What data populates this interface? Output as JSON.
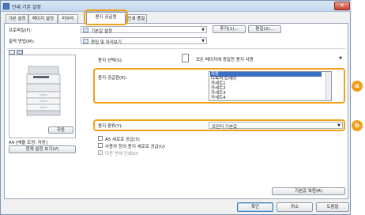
{
  "window": {
    "title": "인쇄 기본 설정",
    "close_glyph": "✕"
  },
  "tabs": [
    {
      "label": "기본 설정"
    },
    {
      "label": "페이지 설정"
    },
    {
      "label": "마무리"
    },
    {
      "label": "용지 공급원"
    },
    {
      "label": "인쇄 품질"
    }
  ],
  "top": {
    "profile_label": "프로파일(F):",
    "profile_value": "기본값 설정",
    "add_button": "추가(1)...",
    "edit_button": "편집(2)...",
    "output_label": "출력 방법(M):",
    "output_value": "편집 및 미리보기"
  },
  "paper": {
    "selection_label": "용지 선택(S):",
    "selection_value": "모든 페이지에 동일한 용지 사용",
    "source_label": "용지 공급원(E):",
    "source_options": [
      "자동",
      "다목적 트레이",
      "카세트1",
      "카세트2",
      "카세트3",
      "카세트4"
    ],
    "source_selected": "자동",
    "type_label": "용지 종류(Y):",
    "type_value": "프린터 기본값",
    "check_a5": "A5 세로로 공급(5)",
    "check_custom": "사용자 정의 용지 세로로 공급(U)",
    "check_reverse": "다른 면에 인쇄(D)",
    "restore_button": "기본값 복원(R)"
  },
  "preview": {
    "auto_button": "자동",
    "status": "A4 [배율 조정: 자동]",
    "view_settings_button": "현재 설정 보기(V)"
  },
  "callouts": {
    "a": "a",
    "b": "b"
  },
  "footer": {
    "ok": "확인",
    "cancel": "취소",
    "help": "도움말"
  }
}
